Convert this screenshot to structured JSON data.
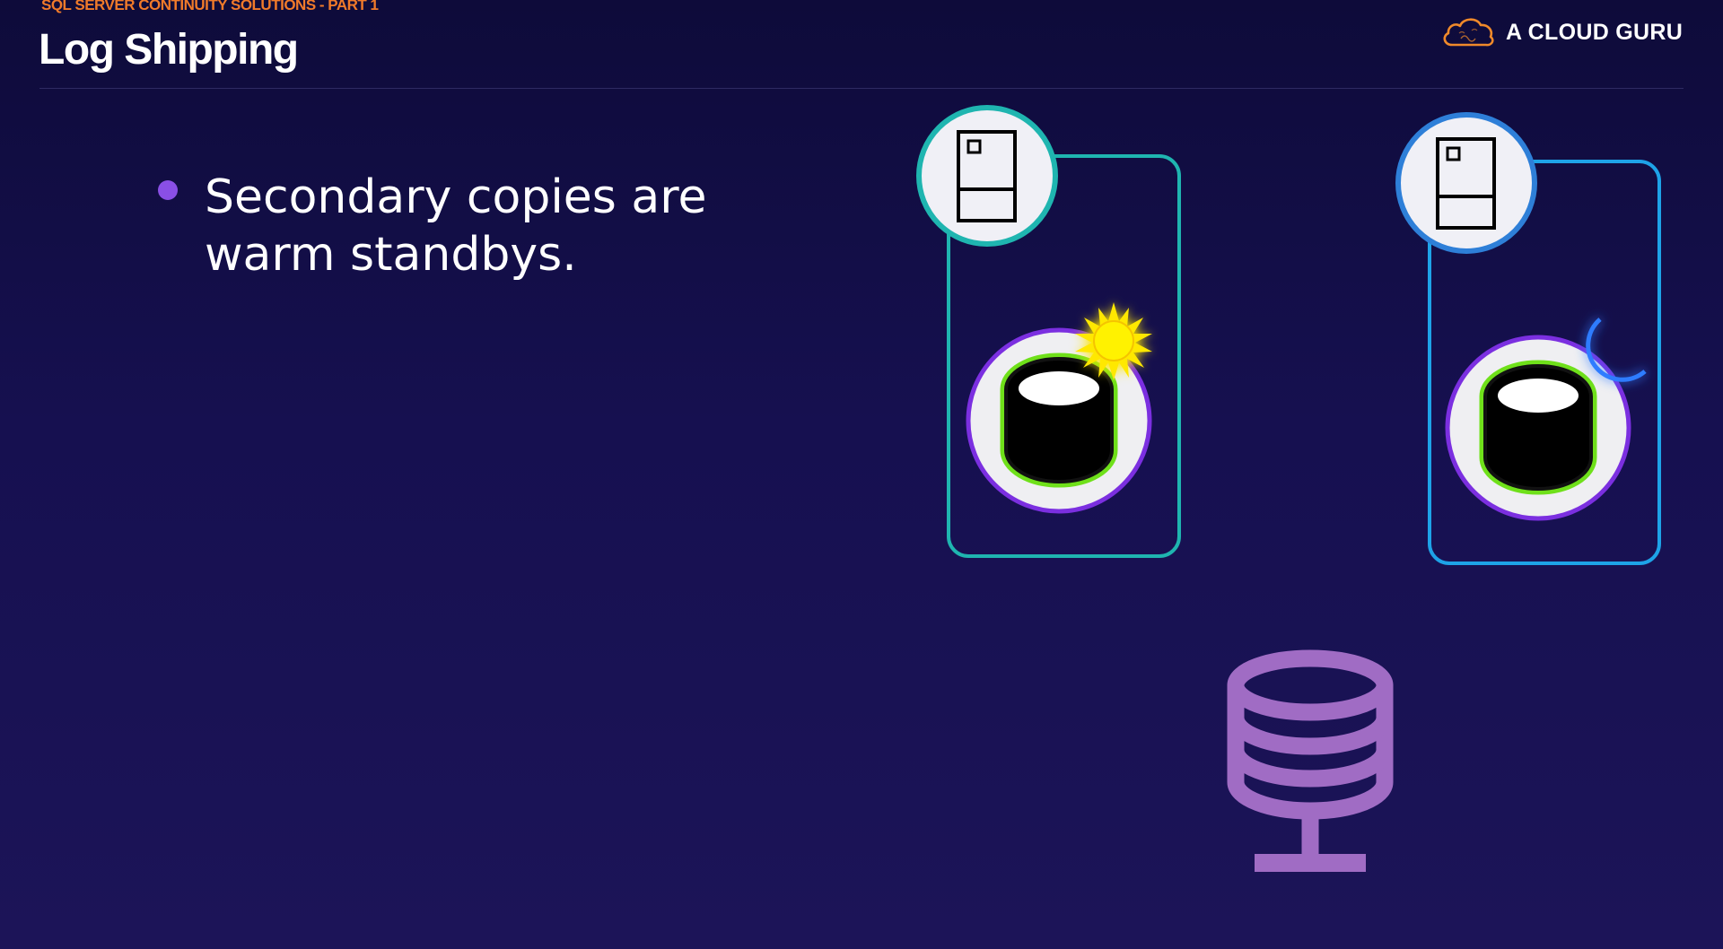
{
  "header": {
    "supertitle": "SQL SERVER CONTINUITY SOLUTIONS - PART 1",
    "title": "Log Shipping"
  },
  "logo": {
    "text": "A CLOUD GURU",
    "icon": "cloud-icon",
    "color": "#f08a2a"
  },
  "content": {
    "bullet_text": "Secondary copies are warm standbys."
  },
  "diagram": {
    "servers": [
      {
        "name": "server-one",
        "frame_color": "#1fb5b0",
        "status_icon": "sun-icon",
        "status_color": "#ffe800"
      },
      {
        "name": "server-two",
        "frame_color": "#1ea3e8",
        "status_icon": "moon-icon",
        "status_color": "#4aa8ff"
      }
    ],
    "database_ring_color": "#7b2fe0",
    "database_glow_color": "#6fe01a",
    "storage_icon": "database-stack-icon",
    "storage_color": "#a06cc4"
  }
}
